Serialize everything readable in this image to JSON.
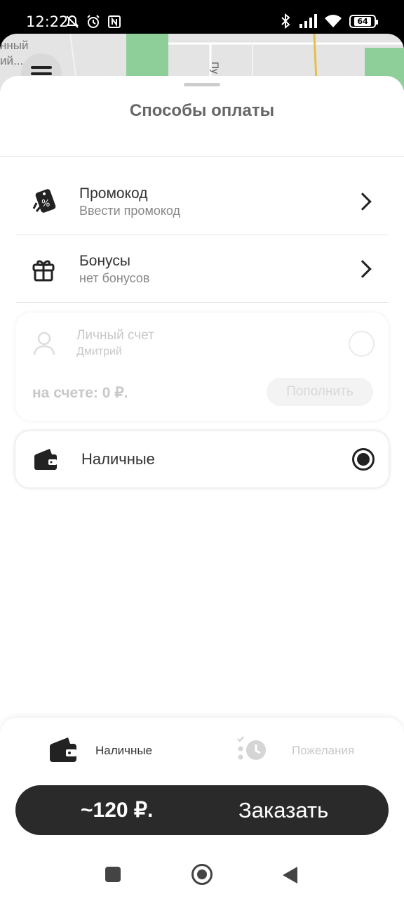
{
  "status_bar": {
    "time": "12:22",
    "battery": "64"
  },
  "map": {
    "street_text": "нный\nий...",
    "street_label": "Пу"
  },
  "sheet": {
    "title": "Способы оплаты",
    "items": [
      {
        "title": "Промокод",
        "subtitle": "Ввести промокод",
        "icon": "promo-tag-icon"
      },
      {
        "title": "Бонусы",
        "subtitle": "нет бонусов",
        "icon": "gift-icon"
      }
    ],
    "account": {
      "title": "Личный счет",
      "name": "Дмитрий",
      "balance": "на счете: 0 ₽.",
      "topup": "Пополнить",
      "selected": false
    },
    "cash": {
      "label": "Наличные",
      "selected": true
    }
  },
  "bottom": {
    "payment_label": "Наличные",
    "wishes_label": "Пожелания",
    "price": "~120 ₽.",
    "order_label": "Заказать"
  },
  "colors": {
    "primary_dark": "#2a2a2a",
    "disabled_text": "#c8c8c8"
  }
}
